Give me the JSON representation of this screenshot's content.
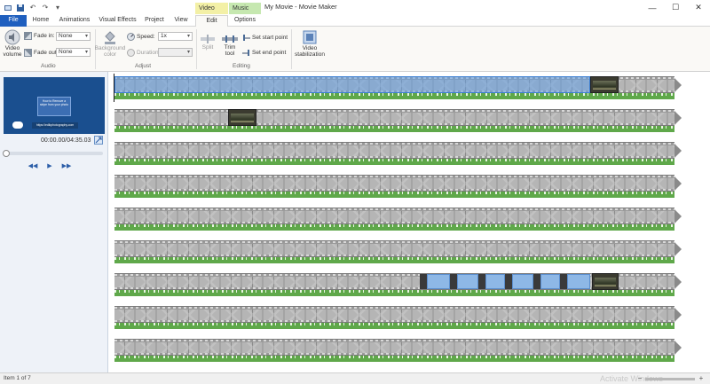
{
  "window": {
    "title": "My Movie - Movie Maker",
    "context_tabs": [
      "Video Tools",
      "Music Tools"
    ],
    "controls": {
      "minimize": "—",
      "maximize": "☐",
      "close": "✕"
    }
  },
  "tabs": [
    "File",
    "Home",
    "Animations",
    "Visual Effects",
    "Project",
    "View",
    "Edit",
    "Options"
  ],
  "ribbon": {
    "audio": {
      "label": "Audio",
      "video_volume": "Video volume",
      "fade_in_label": "Fade in:",
      "fade_in_value": "None",
      "fade_out_label": "Fade out:",
      "fade_out_value": "None"
    },
    "adjust": {
      "label": "Adjust",
      "background_color": "Background color",
      "speed_label": "Speed:",
      "speed_value": "1x",
      "duration_label": "Duration:"
    },
    "editing": {
      "label": "Editing",
      "split": "Split",
      "trim_tool": "Trim tool",
      "set_start_point": "Set start point",
      "set_end_point": "Set end point"
    },
    "stabilization": {
      "label": "Video stabilization"
    }
  },
  "preview": {
    "card_text": "How to Remove a stripe from your photo",
    "url_text": "https://edikphotography.com",
    "timecode": "00:00.00/04:35.03"
  },
  "playback": {
    "prev": "◀◀",
    "play": "▶",
    "next": "▶▶"
  },
  "status": {
    "item_text": "Item 1 of 7",
    "watermark": "Activate Windows",
    "zoom_out": "−",
    "zoom_in": "+"
  },
  "colors": {
    "file_tab": "#1f5fbf",
    "video_tools": "#f3f0a6",
    "music_tools": "#c6e8b0",
    "audio_track": "#5fa84a"
  }
}
